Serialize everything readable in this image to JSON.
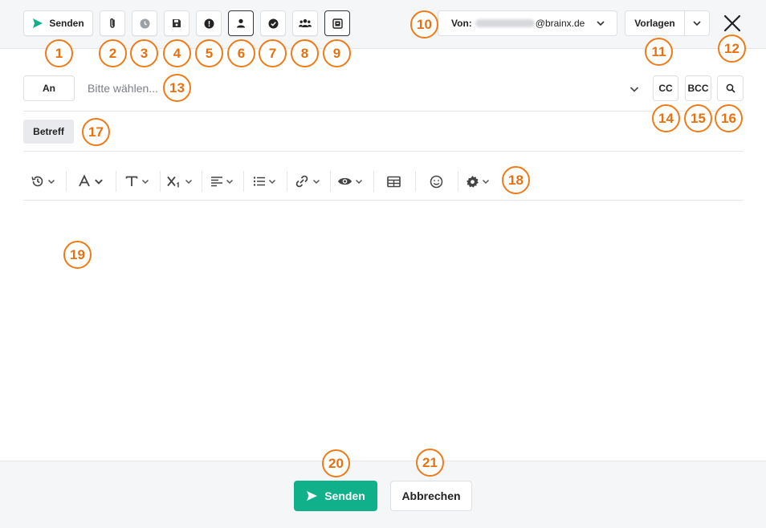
{
  "toolbar": {
    "send_label": "Senden",
    "from_label": "Von:",
    "from_domain": "@brainx.de",
    "templates_label": "Vorlagen"
  },
  "recipients": {
    "to_label": "An",
    "placeholder": "Bitte wählen...",
    "cc_label": "CC",
    "bcc_label": "BCC"
  },
  "subject": {
    "label": "Betreff"
  },
  "footer": {
    "send_label": "Senden",
    "cancel_label": "Abbrechen"
  },
  "annotations": [
    "1",
    "2",
    "3",
    "4",
    "5",
    "6",
    "7",
    "8",
    "9",
    "10",
    "11",
    "12",
    "13",
    "14",
    "15",
    "16",
    "17",
    "18",
    "19",
    "20",
    "21"
  ],
  "colors": {
    "accent": "#10b08a",
    "annotation": "#f07a16"
  }
}
